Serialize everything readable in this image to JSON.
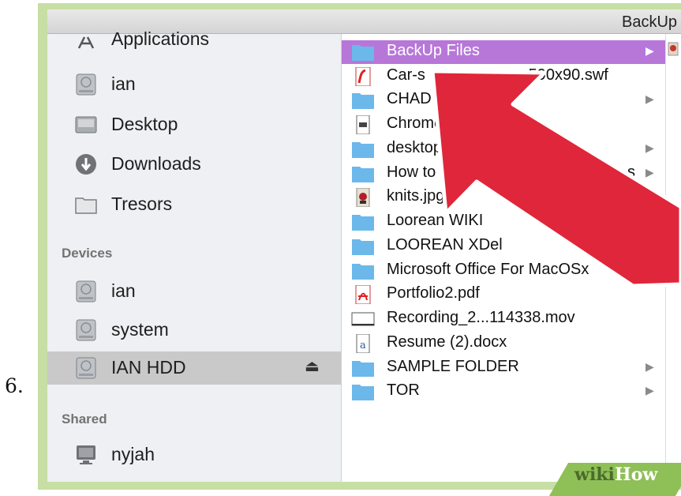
{
  "step_number": "6.",
  "window_title": "BackUp I",
  "sidebar": {
    "partial_item": {
      "label": "Applications",
      "icon": "applications-icon"
    },
    "favorites": [
      {
        "label": "ian",
        "icon": "home-drive-icon"
      },
      {
        "label": "Desktop",
        "icon": "desktop-icon"
      },
      {
        "label": "Downloads",
        "icon": "downloads-icon"
      },
      {
        "label": "Tresors",
        "icon": "folder-icon"
      }
    ],
    "devices_header": "Devices",
    "devices": [
      {
        "label": "ian",
        "icon": "hard-drive-icon"
      },
      {
        "label": "system",
        "icon": "hard-drive-icon"
      },
      {
        "label": "IAN HDD",
        "icon": "hard-drive-icon",
        "selected": true,
        "eject_glyph": "⏏"
      }
    ],
    "shared_header": "Shared",
    "shared": [
      {
        "label": "nyjah",
        "icon": "computer-icon"
      }
    ]
  },
  "files": [
    {
      "name": "BackUp Files",
      "type": "folder",
      "has_children": true,
      "selected": true
    },
    {
      "name": "Car-s",
      "name_tail": "c-590x90.swf",
      "type": "swf"
    },
    {
      "name": "CHAD",
      "type": "folder",
      "has_children": true
    },
    {
      "name": "Chrome",
      "type": "document"
    },
    {
      "name": "desktop",
      "type": "folder",
      "has_children": true
    },
    {
      "name": "How to Use",
      "name_tail": "s",
      "type": "folder",
      "has_children": true
    },
    {
      "name": "knits.jpg",
      "type": "image"
    },
    {
      "name": "Loorean WIKI",
      "type": "folder"
    },
    {
      "name": "LOOREAN XDel",
      "type": "folder"
    },
    {
      "name": "Microsoft Office For MacOSx",
      "type": "folder",
      "has_children": true
    },
    {
      "name": "Portfolio2.pdf",
      "type": "pdf"
    },
    {
      "name": "Recording_2...114338.mov",
      "type": "movie"
    },
    {
      "name": "Resume (2).docx",
      "type": "word"
    },
    {
      "name": "SAMPLE FOLDER",
      "type": "folder",
      "has_children": true
    },
    {
      "name": "TOR",
      "type": "folder",
      "has_children": true
    }
  ],
  "arrow_glyph": "▶",
  "watermark": {
    "prefix": "wiki",
    "suffix": "How"
  },
  "colors": {
    "selection": "#b777d8",
    "sidebar_bg": "#eef0f3",
    "frame": "#c7dfa4",
    "pointer_fill": "#e0263a",
    "pointer_outline": "#ffffff",
    "folder": "#6cb8ea",
    "watermark_green": "#8fbf57"
  }
}
